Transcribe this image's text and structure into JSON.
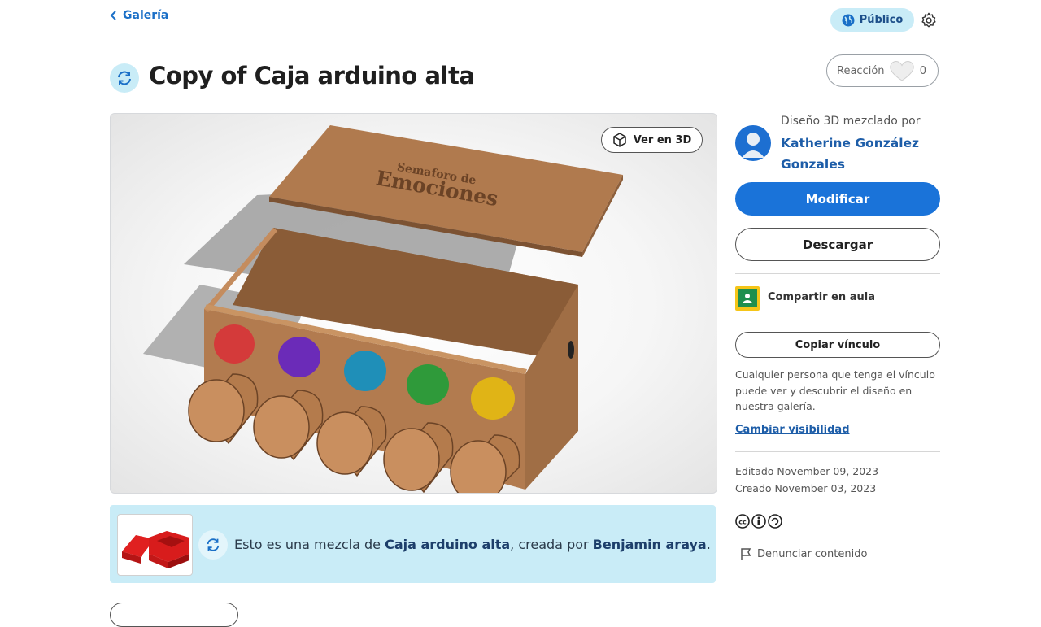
{
  "nav": {
    "back_label": "Galería",
    "back_icon": "chevron-left-icon"
  },
  "header": {
    "visibility_label": "Público",
    "title": "Copy of Caja arduino alta",
    "reaction_label": "Reacción",
    "reaction_count": "0"
  },
  "viewer": {
    "view3d_label": "Ver en 3D",
    "lid_text_line1": "Semaforo de",
    "lid_text_line2": "Emociones",
    "disk_colors": [
      "#d43a3a",
      "#6b2bb8",
      "#1f8fb8",
      "#2f9a3a",
      "#e0b416"
    ],
    "wood_color": "#b07a4e"
  },
  "remix": {
    "prefix": "Esto es una mezcla de ",
    "source": "Caja arduino alta",
    "middle": ", creada por ",
    "creator": "Benjamin araya",
    "suffix": "."
  },
  "sidebar": {
    "mixed_by_label": "Diseño 3D mezclado por",
    "author_name": "Katherine González Gonzales",
    "modify_label": "Modificar",
    "download_label": "Descargar",
    "share_classroom_label": "Compartir en aula",
    "copy_link_label": "Copiar vínculo",
    "link_info": "Cualquier persona que tenga el vínculo puede ver y descubrir el diseño en nuestra galería.",
    "change_visibility_label": "Cambiar visibilidad",
    "edited_label": "Editado November 09, 2023",
    "created_label": "Creado November 03, 2023",
    "license_symbols": "🅭🅯🄎",
    "report_label": "Denunciar contenido"
  },
  "colors": {
    "accent": "#1a73d9",
    "remix_bg": "#c9ecf7",
    "link": "#1d5da8"
  }
}
